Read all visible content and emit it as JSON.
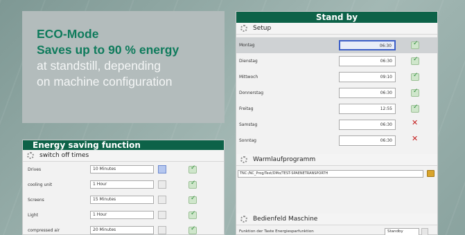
{
  "eco": {
    "line1": "ECO-Mode",
    "line2": "Saves up to 90 % energy",
    "line3": "at standstill, depending",
    "line4": "on machine configuration"
  },
  "standby": {
    "title": "Stand by",
    "setup_label": "Setup",
    "days": [
      {
        "label": "Montag",
        "time": "06:30",
        "status": "ok",
        "selected": true
      },
      {
        "label": "Dienstag",
        "time": "06:30",
        "status": "ok"
      },
      {
        "label": "Mittwoch",
        "time": "09:10",
        "status": "ok"
      },
      {
        "label": "Donnerstag",
        "time": "06:30",
        "status": "ok"
      },
      {
        "label": "Freitag",
        "time": "12:55",
        "status": "ok"
      },
      {
        "label": "Samstag",
        "time": "06:30",
        "status": "no"
      },
      {
        "label": "Sonntag",
        "time": "06:30",
        "status": "no"
      }
    ],
    "warmup_label": "Warmlaufprogramm",
    "warmup_path": "TNC:/NC_Prog/Test/DMo/TEST-SPAENETRANSPORTH",
    "panel_label": "Bedienfeld Maschine",
    "panel_function_label": "Funktion der Taste Energiesparfunktion",
    "panel_function_value": "Standby"
  },
  "energy": {
    "title": "Energy saving function",
    "section_label": "switch off times",
    "rows": [
      {
        "label": "Drives",
        "value": "10 Minutes",
        "dd_active": true
      },
      {
        "label": "cooling unit",
        "value": "1 Hour"
      },
      {
        "label": "Screens",
        "value": "15 Minutes"
      },
      {
        "label": "Light",
        "value": "1 Hour"
      },
      {
        "label": "compressed air",
        "value": "20 Minutes"
      }
    ]
  },
  "colors": {
    "brand_green": "#0d6248",
    "eco_green": "#0f7b5c",
    "selected_border": "#3c5fc8",
    "error_red": "#c41e1e"
  }
}
